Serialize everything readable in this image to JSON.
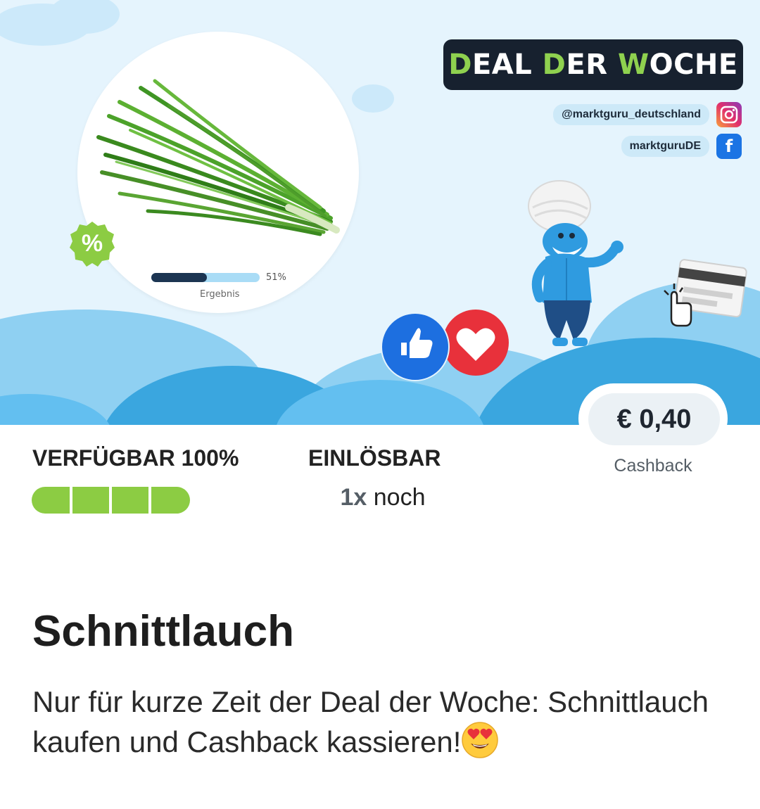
{
  "banner": {
    "deal_title_parts": [
      "D",
      "EAL ",
      "D",
      "ER ",
      "W",
      "OCHE"
    ],
    "instagram_handle": "@marktguru_deutschland",
    "facebook_handle": "marktguruDE",
    "percent_symbol": "%",
    "progress": {
      "value": 0.51,
      "percent_label": "51%",
      "label": "Ergebnis"
    },
    "colors": {
      "accent_green": "#8fd14f",
      "dark_box": "#17212f",
      "sky": "#e5f4fd",
      "hill_blue": "#3aa6df"
    },
    "icons": [
      "instagram-icon",
      "facebook-icon",
      "thumbs-up-icon",
      "heart-icon",
      "card-tap-icon",
      "mascot-illustration"
    ]
  },
  "price": {
    "amount": "€ 0,40",
    "label": "Cashback"
  },
  "stats": {
    "available_label": "VERFÜGBAR 100%",
    "available_fraction": 1.0,
    "available_segments": 4,
    "redeem_label": "EINLÖSBAR",
    "redeem_count": "1x",
    "redeem_suffix": " noch"
  },
  "product": {
    "title": "Schnittlauch",
    "description": "Nur für kurze Zeit der Deal der Woche: Schnittlauch kaufen und Cashback kassieren!",
    "emoji": "heart-eyes-emoji"
  }
}
